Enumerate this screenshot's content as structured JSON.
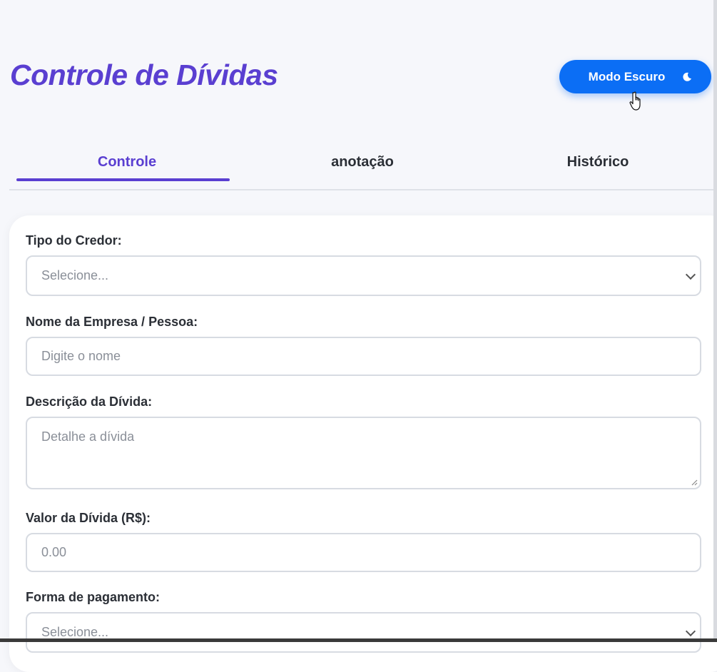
{
  "header": {
    "title": "Controle de Dívidas",
    "mode_button_label": "Modo Escuro",
    "mode_icon": "moon-icon"
  },
  "tabs": [
    {
      "label": "Controle",
      "active": true
    },
    {
      "label": "anotação",
      "active": false
    },
    {
      "label": "Histórico",
      "active": false
    }
  ],
  "form": {
    "creditor_type": {
      "label": "Tipo do Credor:",
      "selected": "Selecione..."
    },
    "name": {
      "label": "Nome da Empresa / Pessoa:",
      "placeholder": "Digite o nome"
    },
    "description": {
      "label": "Descrição da Dívida:",
      "placeholder": "Detalhe a dívida"
    },
    "amount": {
      "label": "Valor da Dívida (R$):",
      "placeholder": "0.00"
    },
    "payment_method": {
      "label": "Forma de pagamento:",
      "selected": "Selecione..."
    }
  },
  "colors": {
    "accent": "#5a3fd1",
    "button": "#0b6ef5",
    "background": "#f6f7fb"
  }
}
